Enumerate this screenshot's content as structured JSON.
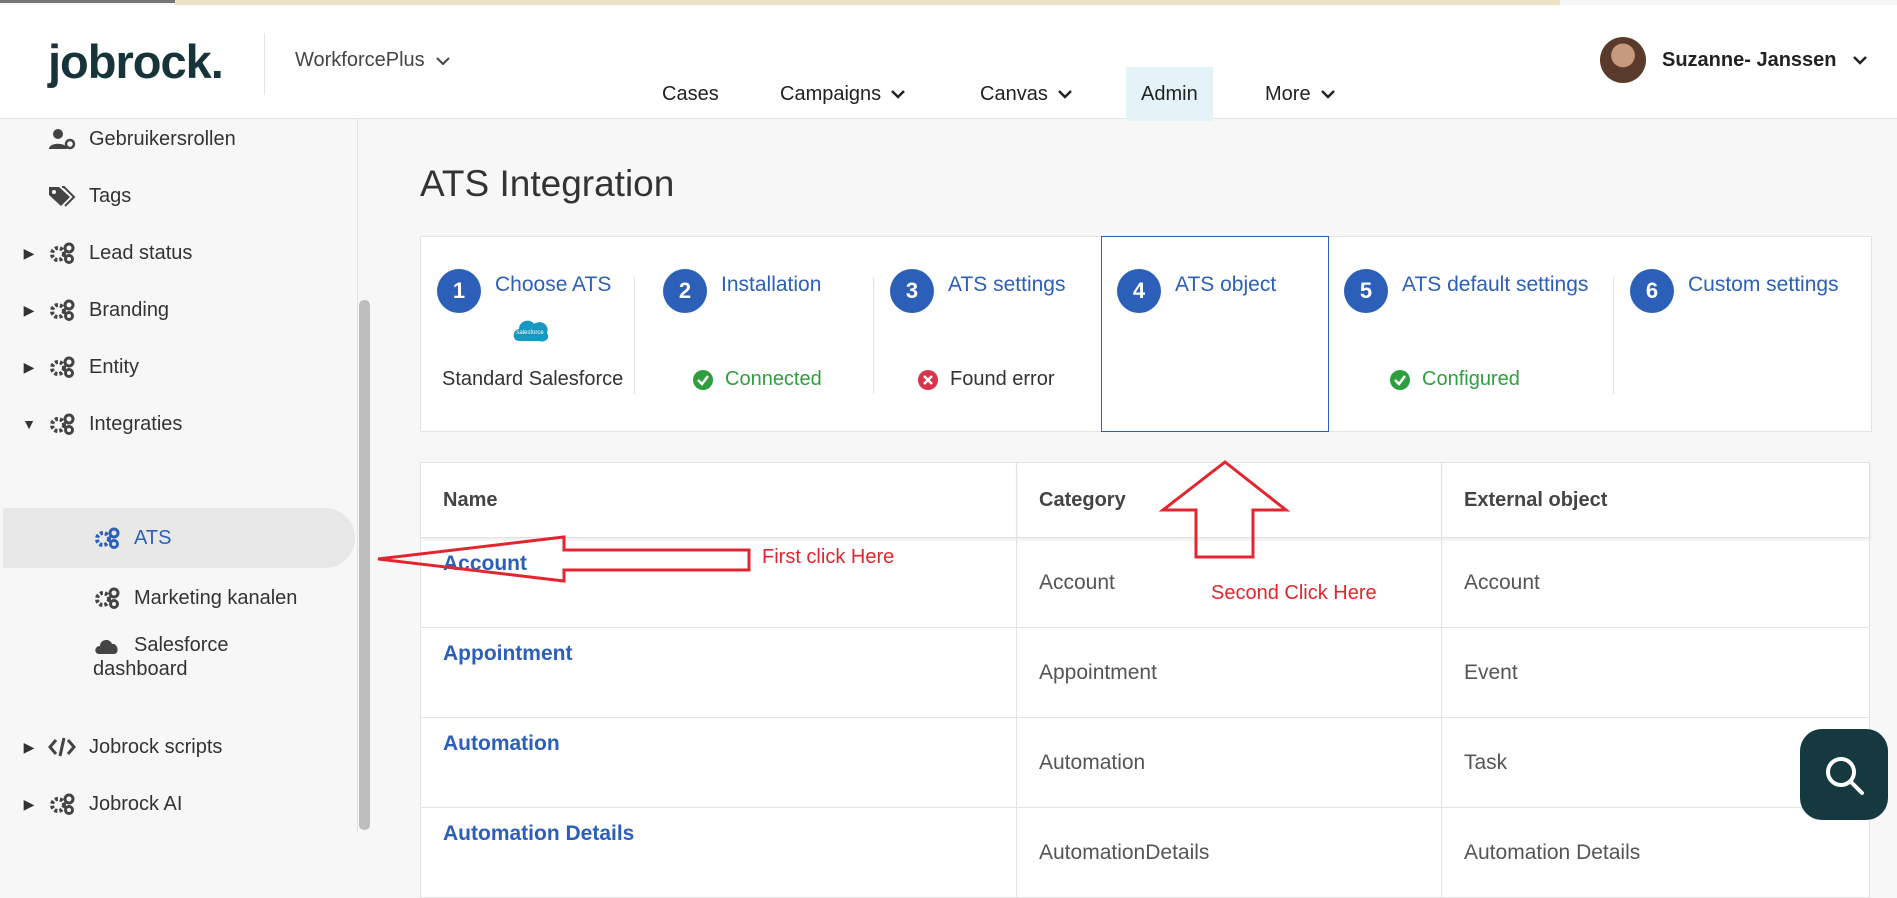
{
  "header": {
    "logo": "jobrock.",
    "workspace": "WorkforcePlus",
    "nav": [
      {
        "label": "Cases"
      },
      {
        "label": "Campaigns"
      },
      {
        "label": "Canvas"
      },
      {
        "label": "Admin"
      },
      {
        "label": "More"
      }
    ],
    "user_name": "Suzanne- Janssen"
  },
  "sidebar": {
    "items": [
      {
        "label": "Gebruikersrollen",
        "icon": "user-cog-icon"
      },
      {
        "label": "Tags",
        "icon": "tags-icon"
      },
      {
        "label": "Lead status",
        "icon": "cogs-icon"
      },
      {
        "label": "Branding",
        "icon": "cogs-icon"
      },
      {
        "label": "Entity",
        "icon": "cogs-icon"
      },
      {
        "label": "Integraties",
        "icon": "cogs-icon"
      },
      {
        "label": "ATS",
        "icon": "cogs-icon"
      },
      {
        "label": "Marketing kanalen",
        "icon": "cogs-icon"
      },
      {
        "label": "Salesforce",
        "label2": "dashboard",
        "icon": "cloud-icon"
      },
      {
        "label": "Jobrock scripts",
        "icon": "code-icon"
      },
      {
        "label": "Jobrock AI",
        "icon": "cogs-icon"
      }
    ]
  },
  "main": {
    "title": "ATS Integration",
    "steps": [
      {
        "num": "1",
        "title": "Choose ATS",
        "status": "Standard Salesforce",
        "logo": "salesforce"
      },
      {
        "num": "2",
        "title": "Installation",
        "status": "Connected"
      },
      {
        "num": "3",
        "title": "ATS settings",
        "status": "Found error"
      },
      {
        "num": "4",
        "title": "ATS object",
        "status": ""
      },
      {
        "num": "5",
        "title": "ATS default settings",
        "status": "Configured"
      },
      {
        "num": "6",
        "title": "Custom settings",
        "status": ""
      }
    ],
    "table": {
      "headers": [
        "Name",
        "Category",
        "External object"
      ],
      "rows": [
        [
          "Account",
          "Account",
          "Account"
        ],
        [
          "Appointment",
          "Appointment",
          "Event"
        ],
        [
          "Automation",
          "Automation",
          "Task"
        ],
        [
          "Automation Details",
          "AutomationDetails",
          "Automation Details"
        ]
      ]
    }
  },
  "annotations": {
    "first": "First click Here",
    "second": "Second Click Here"
  },
  "colors": {
    "accent": "#2c5fb8",
    "success": "#2e9e3e",
    "error": "#e2262f",
    "annotation": "#e2262f"
  }
}
